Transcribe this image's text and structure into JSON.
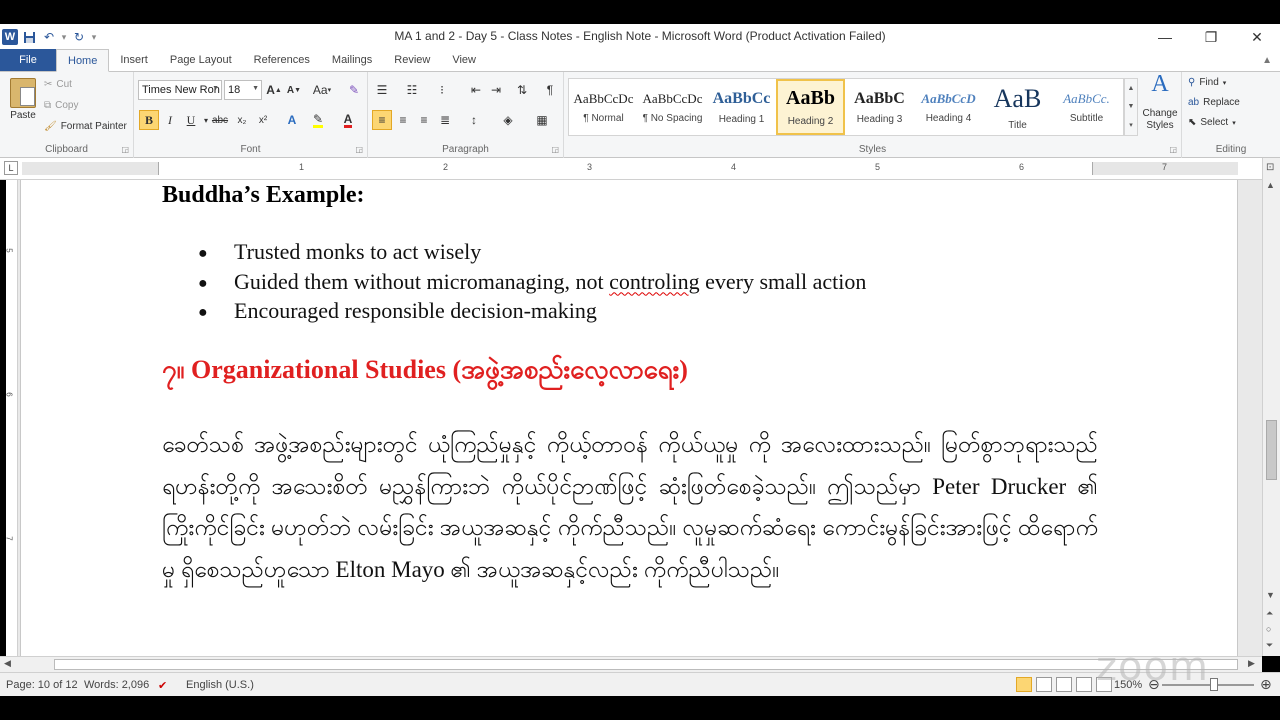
{
  "window": {
    "title": "MA 1 and 2 - Day 5 - Class Notes - English Note  -  Microsoft Word (Product Activation Failed)",
    "app_icon": "W",
    "controls": [
      "—",
      "❐",
      "✕"
    ]
  },
  "tabs": [
    {
      "label": "File"
    },
    {
      "label": "Home"
    },
    {
      "label": "Insert"
    },
    {
      "label": "Page Layout"
    },
    {
      "label": "References"
    },
    {
      "label": "Mailings"
    },
    {
      "label": "Review"
    },
    {
      "label": "View"
    }
  ],
  "ribbon": {
    "clipboard": {
      "paste": "Paste",
      "cut": "Cut",
      "copy": "Copy",
      "format_painter": "Format Painter",
      "label": "Clipboard"
    },
    "font": {
      "name": "Times New Ron",
      "size": "18",
      "label": "Font"
    },
    "paragraph": {
      "label": "Paragraph"
    },
    "styles": {
      "label": "Styles",
      "items": [
        {
          "sample": "AaBbCcDc",
          "name": "¶ Normal"
        },
        {
          "sample": "AaBbCcDc",
          "name": "¶ No Spacing"
        },
        {
          "sample": "AaBbCc",
          "name": "Heading 1"
        },
        {
          "sample": "AaBb",
          "name": "Heading 2"
        },
        {
          "sample": "AaBbC",
          "name": "Heading 3"
        },
        {
          "sample": "AaBbCcD",
          "name": "Heading 4"
        },
        {
          "sample": "AaB",
          "name": "Title"
        },
        {
          "sample": "AaBbCc.",
          "name": "Subtitle"
        }
      ],
      "change_styles": "Change Styles"
    },
    "editing": {
      "find": "Find",
      "replace": "Replace",
      "select": "Select",
      "label": "Editing"
    }
  },
  "ruler": {
    "numbers": [
      "1",
      "2",
      "3",
      "4",
      "5",
      "6",
      "7"
    ],
    "v_numbers": [
      "5",
      "6",
      "7"
    ]
  },
  "document": {
    "heading1": "Buddha’s Example:",
    "bullets": [
      {
        "pre": "Trusted monks to act wisely",
        "squiggle": "",
        "post": ""
      },
      {
        "pre": "Guided them without micromanaging, not ",
        "squiggle": "controling",
        "post": " every small action"
      },
      {
        "pre": "Encouraged responsible decision-making",
        "squiggle": "",
        "post": ""
      }
    ],
    "heading2": "၇။ Organizational Studies (အဖွဲ့အစည်းလေ့လာရေး)",
    "paragraph": "ခေတ်သစ် အဖွဲ့အစည်းများတွင် ယုံကြည်မှုနှင့် ကိုယ့်တာဝန် ကိုယ်ယူမှု ကို အလေးထားသည်။ မြတ်စွာဘုရားသည် ရဟန်းတို့ကို အသေးစိတ် မညွှန်ကြားဘဲ ကိုယ်ပိုင်ဉာဏ်ဖြင့် ဆုံးဖြတ်စေခဲ့သည်။ ဤသည်မှာ Peter Drucker ၏ ကြိုးကိုင်ခြင်း မဟုတ်ဘဲ လမ်းခြင်း အယူအဆနှင့် ကိုက်ညီသည်။ လူမှုဆက်ဆံရေး ကောင်းမွန်ခြင်းအားဖြင့် ထိရောက်မှု ရှိစေသည်ဟူသော Elton Mayo ၏ အယူအဆနှင့်လည်း ကိုက်ညီပါသည်။"
  },
  "status": {
    "page": "Page: 10 of 12",
    "words": "Words: 2,096",
    "language": "English (U.S.)",
    "zoom": "150%",
    "zoom_level": 0.57
  },
  "watermark": "zoom",
  "colors": {
    "accent": "#2b579a",
    "heading_red": "#e02020",
    "selected_style": "#f0c24a"
  }
}
